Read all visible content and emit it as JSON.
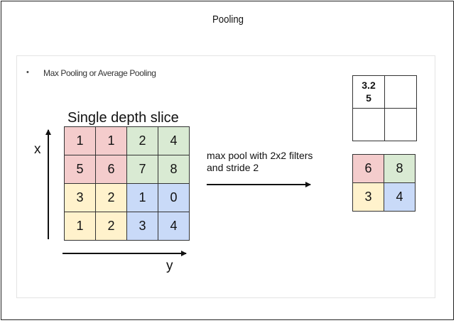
{
  "slide": {
    "title": "Pooling",
    "bullet": "Max Pooling or Average Pooling"
  },
  "input": {
    "label": "Single depth slice",
    "x_label": "x",
    "y_label": "y",
    "rows": [
      [
        1,
        1,
        2,
        4
      ],
      [
        5,
        6,
        7,
        8
      ],
      [
        3,
        2,
        1,
        0
      ],
      [
        1,
        2,
        3,
        4
      ]
    ],
    "quadrant_colors": {
      "top_left": "#f4cccc",
      "top_right": "#d9ead3",
      "bottom_left": "#fff2cc",
      "bottom_right": "#c9daf8"
    }
  },
  "operation": {
    "line1": "max pool with 2x2 filters",
    "line2": "and stride 2"
  },
  "output": {
    "rows": [
      [
        6,
        8
      ],
      [
        3,
        4
      ]
    ]
  },
  "average_output": {
    "first_line": "3.2",
    "second_line": "5"
  }
}
